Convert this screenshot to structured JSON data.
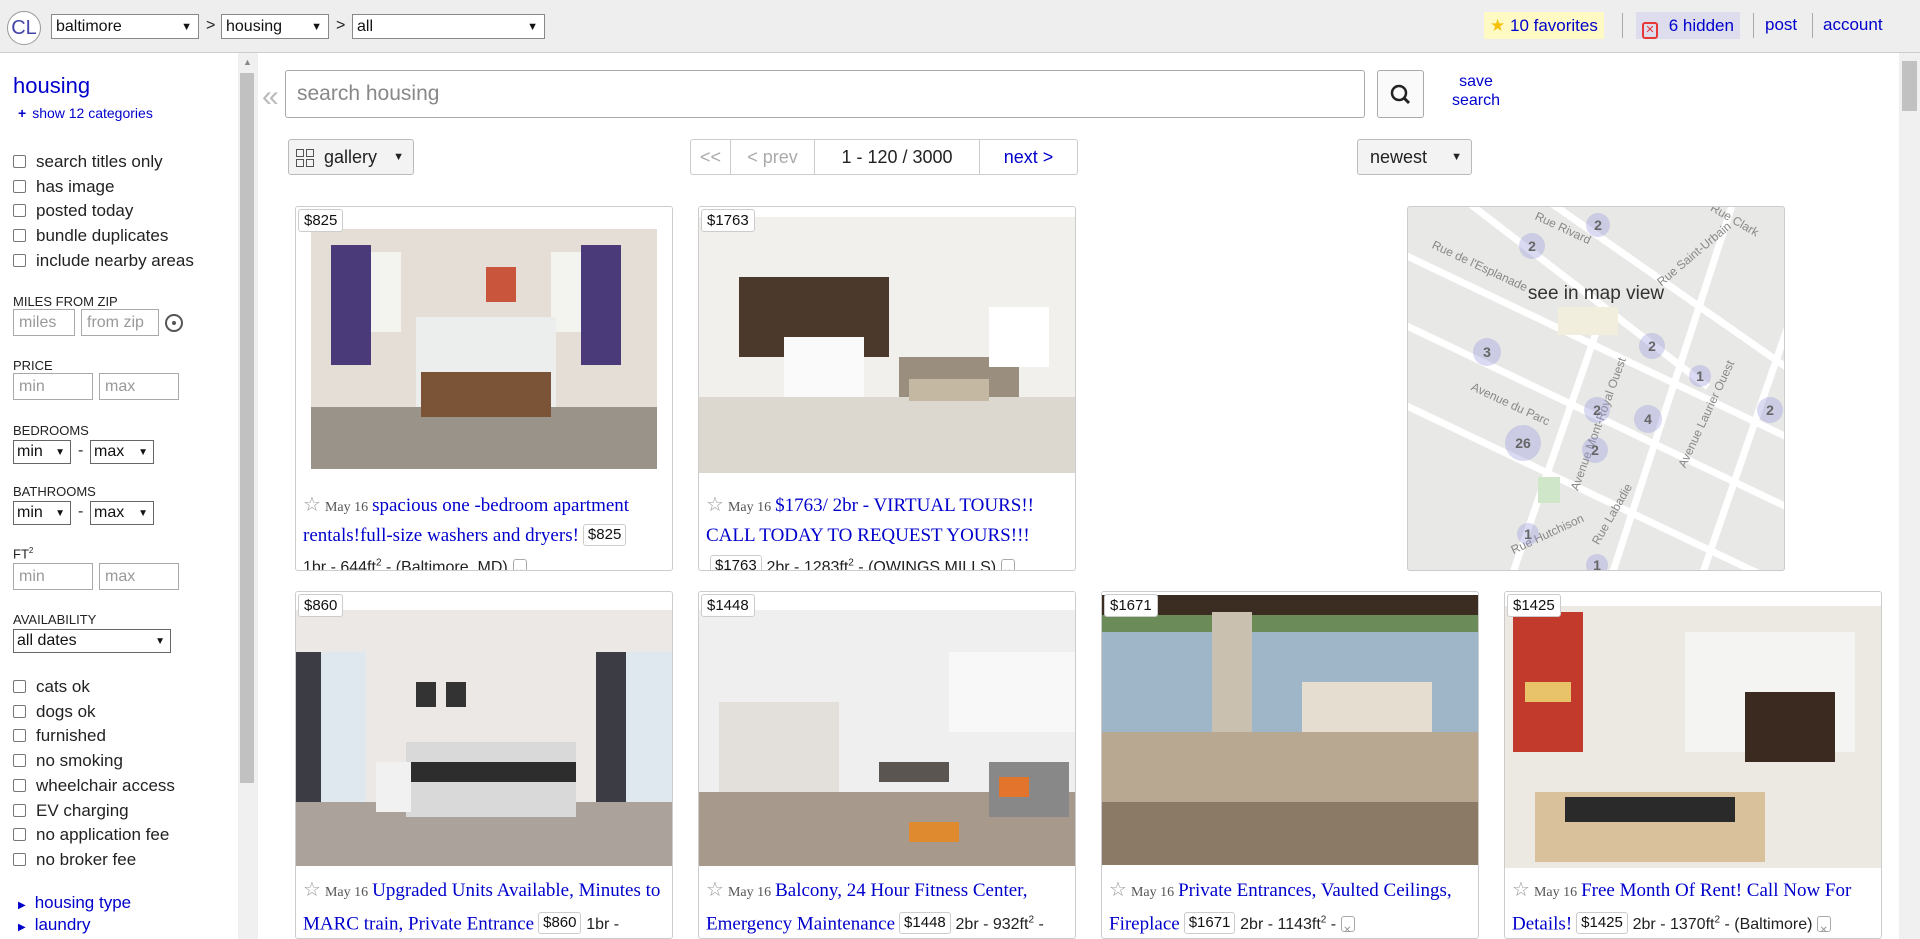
{
  "header": {
    "logo": "CL",
    "location": "baltimore",
    "category": "housing",
    "subcategory": "all",
    "separator": ">",
    "favorites": "10 favorites",
    "hidden": "6 hidden",
    "post": "post",
    "account": "account"
  },
  "sidebar": {
    "title": "housing",
    "show_categories": "show 12 categories",
    "checkboxes_top": [
      "search titles only",
      "has image",
      "posted today",
      "bundle duplicates",
      "include nearby areas"
    ],
    "miles_label": "MILES FROM ZIP",
    "miles_placeholder": "miles",
    "zip_placeholder": "from zip",
    "price_label": "PRICE",
    "min_placeholder": "min",
    "max_placeholder": "max",
    "bedrooms_label": "BEDROOMS",
    "bathrooms_label": "BATHROOMS",
    "sel_min": "min",
    "sel_max": "max",
    "dash": "-",
    "ft_label": "FT",
    "ft_sup": "2",
    "availability_label": "AVAILABILITY",
    "availability_value": "all dates",
    "checkboxes_bottom": [
      "cats ok",
      "dogs ok",
      "furnished",
      "no smoking",
      "wheelchair access",
      "EV charging",
      "no application fee",
      "no broker fee"
    ],
    "links": [
      "housing type",
      "laundry"
    ]
  },
  "main": {
    "collapse_glyph": "«",
    "search_placeholder": "search housing",
    "save_search_1": "save",
    "save_search_2": "search",
    "view_mode": "gallery",
    "pager": {
      "first": "<<",
      "prev": "< prev",
      "range": "1 - 120 / 3000",
      "next": "next >"
    },
    "sort": "newest",
    "map_label": "see in map view"
  },
  "listings": [
    {
      "price": "$825",
      "date": "May 16",
      "title": "spacious one -bedroom apartment rentals!full-size washers and dryers!",
      "pill": "$825",
      "meta": "1br - 644ft",
      "sup": "2",
      "location": " - (Baltimore, MD)"
    },
    {
      "price": "$1763",
      "date": "May 16",
      "title": "$1763/ 2br - VIRTUAL TOURS!! CALL TODAY TO REQUEST YOURS!!!",
      "pill": "$1763",
      "meta": "2br - 1283ft",
      "sup": "2",
      "location": " - (OWINGS MILLS)"
    },
    {
      "price": "$860",
      "date": "May 16",
      "title": "Upgraded Units Available, Minutes to MARC train, Private Entrance",
      "pill": "$860",
      "meta": "1br -",
      "sup": "",
      "location": ""
    },
    {
      "price": "$1448",
      "date": "May 16",
      "title": "Balcony, 24 Hour Fitness Center, Emergency Maintenance",
      "pill": "$1448",
      "meta": "2br - 932ft",
      "sup": "2",
      "location": " -"
    },
    {
      "price": "$1671",
      "date": "May 16",
      "title": "Private Entrances, Vaulted Ceilings, Fireplace",
      "pill": "$1671",
      "meta": "2br - 1143ft",
      "sup": "2",
      "location": " -"
    },
    {
      "price": "$1425",
      "date": "May 16",
      "title": "Free Month Of Rent! Call Now For Details!",
      "pill": "$1425",
      "meta": "2br - 1370ft",
      "sup": "2",
      "location": " - (Baltimore)"
    }
  ],
  "map_clusters": [
    "2",
    "2",
    "3",
    "2",
    "1",
    "2",
    "4",
    "2",
    "26",
    "2",
    "1",
    "1"
  ],
  "map_streets": [
    "Rue Rivard",
    "Rue de l'Esplanade",
    "Rue Clark",
    "Rue Saint-Urbain",
    "Avenue du Parc",
    "Avenue Mont-Royal Ouest",
    "Avenue Laurier Ouest",
    "Rue Hutchison",
    "Rue Labadie"
  ],
  "colors": {
    "link": "#0000cc",
    "favorites_bg": "#fff9c4",
    "hidden_bg": "#ddddee",
    "hidden_icon": "#e53935",
    "star": "#f4c20d"
  }
}
